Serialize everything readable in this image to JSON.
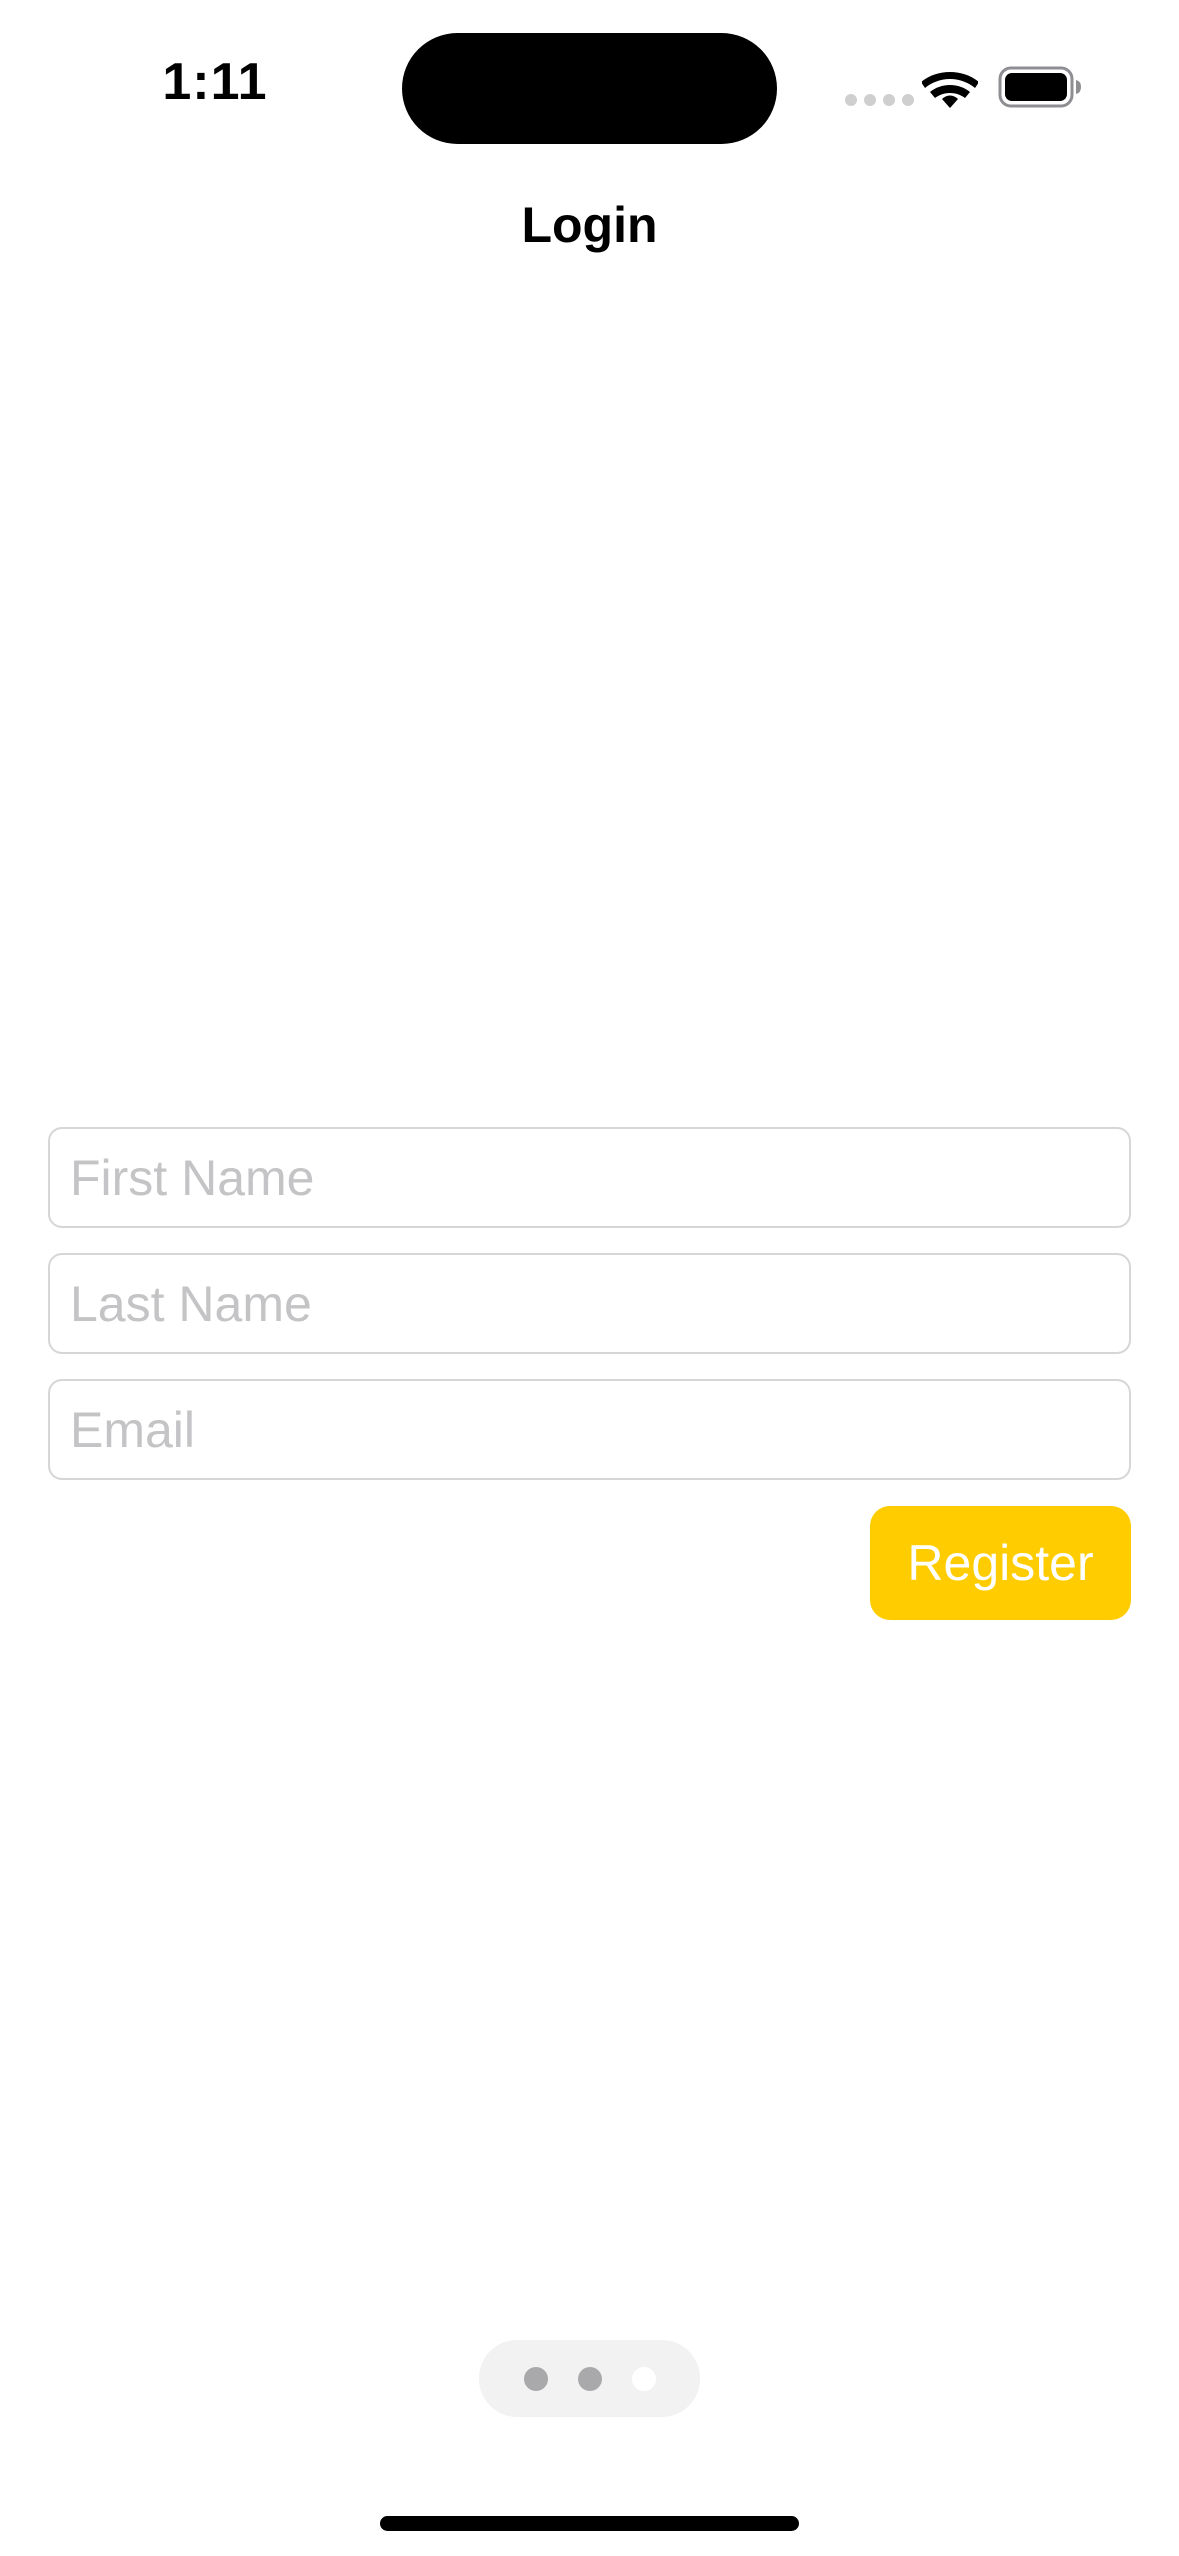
{
  "status_bar": {
    "time": "1:11",
    "icons": {
      "signal": "cellular-signal-icon",
      "wifi": "wifi-icon",
      "battery": "battery-icon"
    }
  },
  "nav": {
    "title": "Login"
  },
  "form": {
    "first_name": {
      "value": "",
      "placeholder": "First Name"
    },
    "last_name": {
      "value": "",
      "placeholder": "Last Name"
    },
    "email": {
      "value": "",
      "placeholder": "Email"
    },
    "register_label": "Register"
  },
  "page_control": {
    "page_count": 3,
    "current_page": 3
  },
  "colors": {
    "accent": "#ffcc00",
    "placeholder": "#c4c4c6",
    "field_border": "#d6d6d8",
    "page_dot": "#a9a9ab",
    "page_control_bg": "#f2f2f3"
  }
}
